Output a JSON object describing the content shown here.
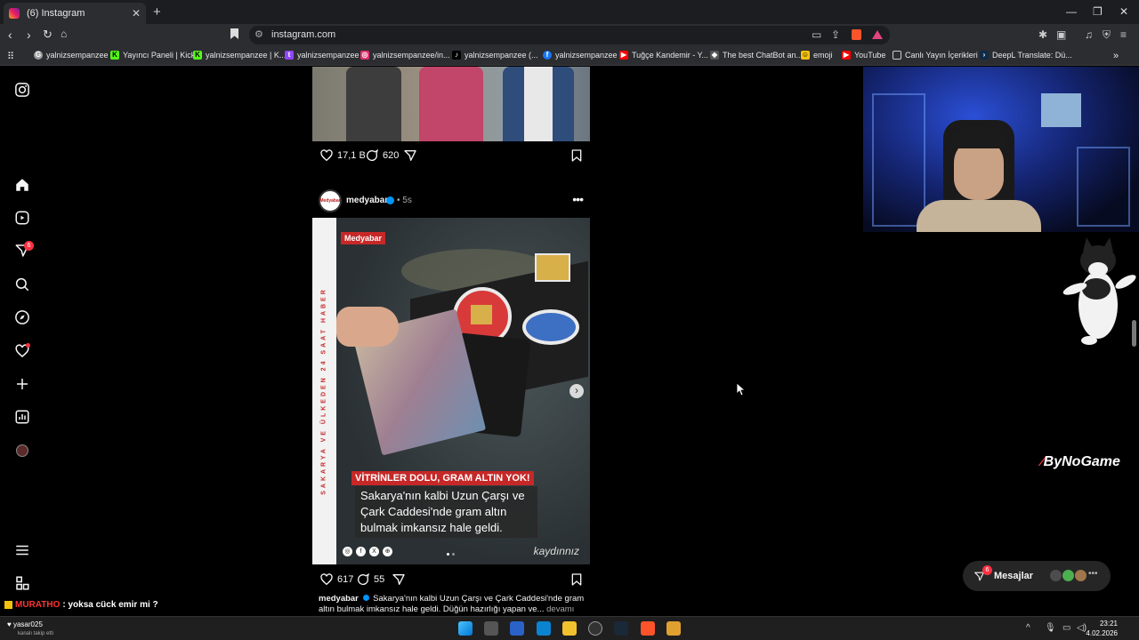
{
  "browser": {
    "tab_title": "(6) Instagram",
    "tab_close": "✕",
    "new_tab": "+",
    "url": "instagram.com",
    "window_controls": [
      "—",
      "❐",
      "✕"
    ]
  },
  "bookmarks": [
    {
      "label": "yalnizsempanzee",
      "color": "#9e9e9e",
      "glyph": "G"
    },
    {
      "label": "Yayıncı Paneli | Kick",
      "color": "#53fc18",
      "glyph": "K"
    },
    {
      "label": "yalnizsempanzee | K...",
      "color": "#53fc18",
      "glyph": "K"
    },
    {
      "label": "yalnizsempanzee",
      "color": "#9146ff",
      "glyph": "t"
    },
    {
      "label": "yalnizsempanzee/in...",
      "color": "#e1306c",
      "glyph": "◎"
    },
    {
      "label": "yalnizsempanzee (...",
      "color": "#000000",
      "glyph": "♪"
    },
    {
      "label": "yalnizsempanzee",
      "color": "#1877f2",
      "glyph": "f"
    },
    {
      "label": "Tuğçe Kandemir - Y...",
      "color": "#ff0000",
      "glyph": "▶"
    },
    {
      "label": "The best ChatBot an...",
      "color": "#555555",
      "glyph": "◆"
    },
    {
      "label": "emoji",
      "color": "#f4c20d",
      "glyph": "☺"
    },
    {
      "label": "YouTube",
      "color": "#ff0000",
      "glyph": "▶"
    },
    {
      "label": "Canlı Yayın İçerikleri",
      "color": "#2c2d31",
      "glyph": "▭"
    },
    {
      "label": "DeepL Translate: Dü...",
      "color": "#0f2b46",
      "glyph": "›"
    }
  ],
  "sidebar": {
    "notification_count": "6"
  },
  "feed": {
    "post1": {
      "likes": "17,1 B",
      "comments": "620"
    },
    "post2": {
      "username": "medyabar",
      "time": "• 5s",
      "avatar_text": "Medyabar",
      "brand_tag": "Medyabar",
      "side_strip": "SAKARYA VE ÜLKEDEN 24 SAAT HABER",
      "headline_red": "VİTRİNLER DOLU, GRAM ALTIN YOK!",
      "headline_body": "Sakarya'nın kalbi Uzun Çarşı ve Çark Caddesi'nde gram altın bulmak imkansız hale geldi.",
      "watermark": "kaydınnız",
      "likes": "617",
      "comments": "55",
      "caption_user": "medyabar",
      "caption_text": "Sakarya'nın kalbi Uzun Çarşı ve Çark Caddesi'nde gram altın bulmak imkansız hale geldi. Düğün hazırlığı yapan ve...",
      "caption_more": "devamı"
    }
  },
  "overlay": {
    "sponsor": "ByNoGame",
    "messages_label": "Mesajlar",
    "messages_badge": "6",
    "chat_user": "MURATHO",
    "chat_text": ": yoksa cück emir mi ?"
  },
  "taskbar": {
    "follower_name": "yasar025",
    "follower_sub": "kanalı takip etti",
    "time": "23:21",
    "date": "4.02.2026"
  },
  "colors": {
    "instagram_bg": "#000000",
    "notification_red": "#ff3040",
    "verified_blue": "#0095f6",
    "news_red": "#c62828"
  }
}
